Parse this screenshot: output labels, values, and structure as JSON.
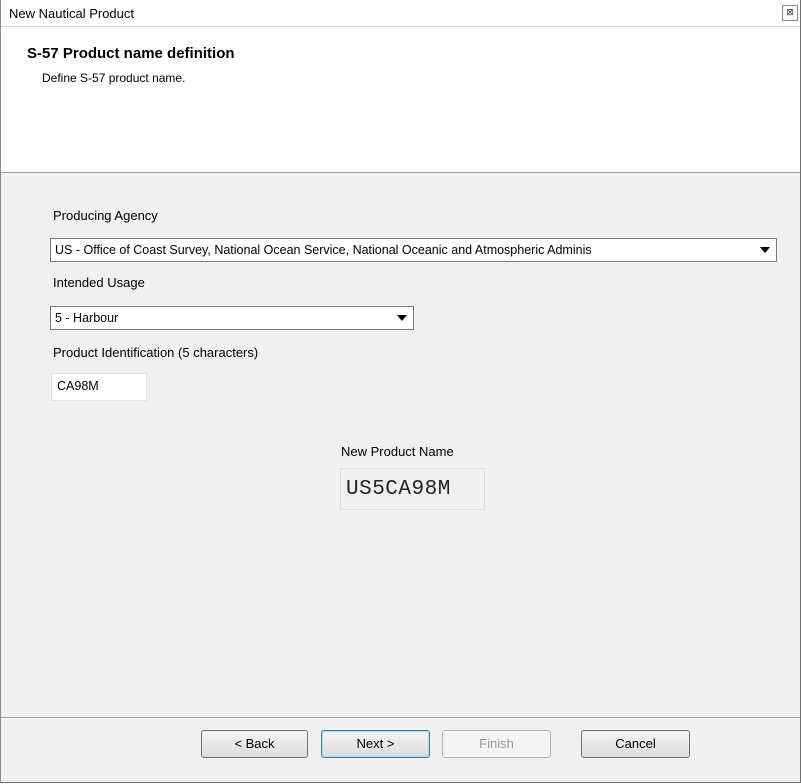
{
  "window": {
    "title": "New Nautical Product",
    "close_glyph": "⊠"
  },
  "header": {
    "title": "S-57 Product name definition",
    "subtitle": "Define S-57 product name."
  },
  "form": {
    "producing_agency": {
      "label": "Producing Agency",
      "selected": "US - Office of Coast Survey, National Ocean Service, National Oceanic and Atmospheric Adminis"
    },
    "intended_usage": {
      "label": "Intended Usage",
      "selected": "5 - Harbour"
    },
    "product_id": {
      "label": "Product Identification (5 characters)",
      "value": "CA98M"
    },
    "new_product_name": {
      "label": "New Product Name",
      "value": "US5CA98M"
    }
  },
  "buttons": {
    "back": "< Back",
    "next": "Next >",
    "finish": "Finish",
    "cancel": "Cancel"
  }
}
